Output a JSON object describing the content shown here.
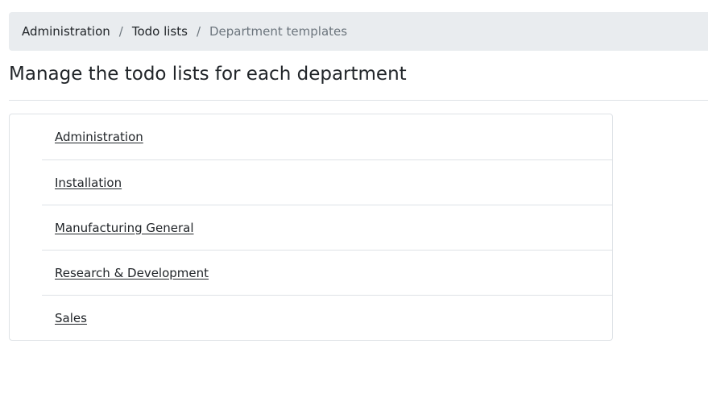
{
  "breadcrumb": {
    "items": [
      {
        "label": "Administration"
      },
      {
        "label": "Todo lists"
      }
    ],
    "separator": "/",
    "current": "Department templates"
  },
  "page": {
    "title": "Manage the todo lists for each department"
  },
  "departments": [
    {
      "label": "Administration"
    },
    {
      "label": "Installation"
    },
    {
      "label": "Manufacturing General"
    },
    {
      "label": "Research & Development"
    },
    {
      "label": "Sales"
    }
  ]
}
